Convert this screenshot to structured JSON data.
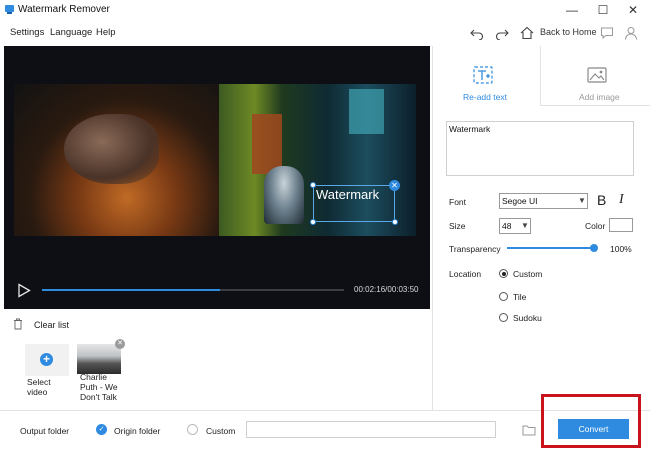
{
  "app": {
    "title": "Watermark Remover"
  },
  "window_controls": {
    "minimize": "—",
    "maximize": "☐",
    "close": "✕"
  },
  "menu": {
    "items": [
      "Settings",
      "Language",
      "Help"
    ]
  },
  "toolbar": {
    "back_home_label": "Back to Home"
  },
  "player": {
    "time": "00:02:16/00:03:50",
    "progress": 0.59
  },
  "watermark": {
    "text": "Watermark"
  },
  "clip_list": {
    "clear_label": "Clear list",
    "select_video_label": "Select video",
    "clips": [
      {
        "name": "Charlie Puth - We Don't Talk"
      }
    ]
  },
  "panel": {
    "tabs": [
      {
        "label": "Re-add text",
        "active": true
      },
      {
        "label": "Add image",
        "active": false
      }
    ],
    "text_value": "Watermark",
    "font_label": "Font",
    "font_value": "Segoe UI",
    "bold": "B",
    "italic": "I",
    "size_label": "Size",
    "size_value": "48",
    "color_label": "Color",
    "color_value": "#ffffff",
    "transparency_label": "Transparency",
    "transparency_value": "100%",
    "transparency_level": 1.0,
    "location_label": "Location",
    "location_options": [
      {
        "label": "Custom",
        "selected": true
      },
      {
        "label": "Tile",
        "selected": false
      },
      {
        "label": "Sudoku",
        "selected": false
      }
    ]
  },
  "bottom": {
    "output_folder_label": "Output folder",
    "origin_folder_label": "Origin folder",
    "custom_label": "Custom",
    "path_value": "",
    "convert_label": "Convert"
  },
  "colors": {
    "accent": "#2f8be0",
    "highlight": "#c8121c"
  }
}
